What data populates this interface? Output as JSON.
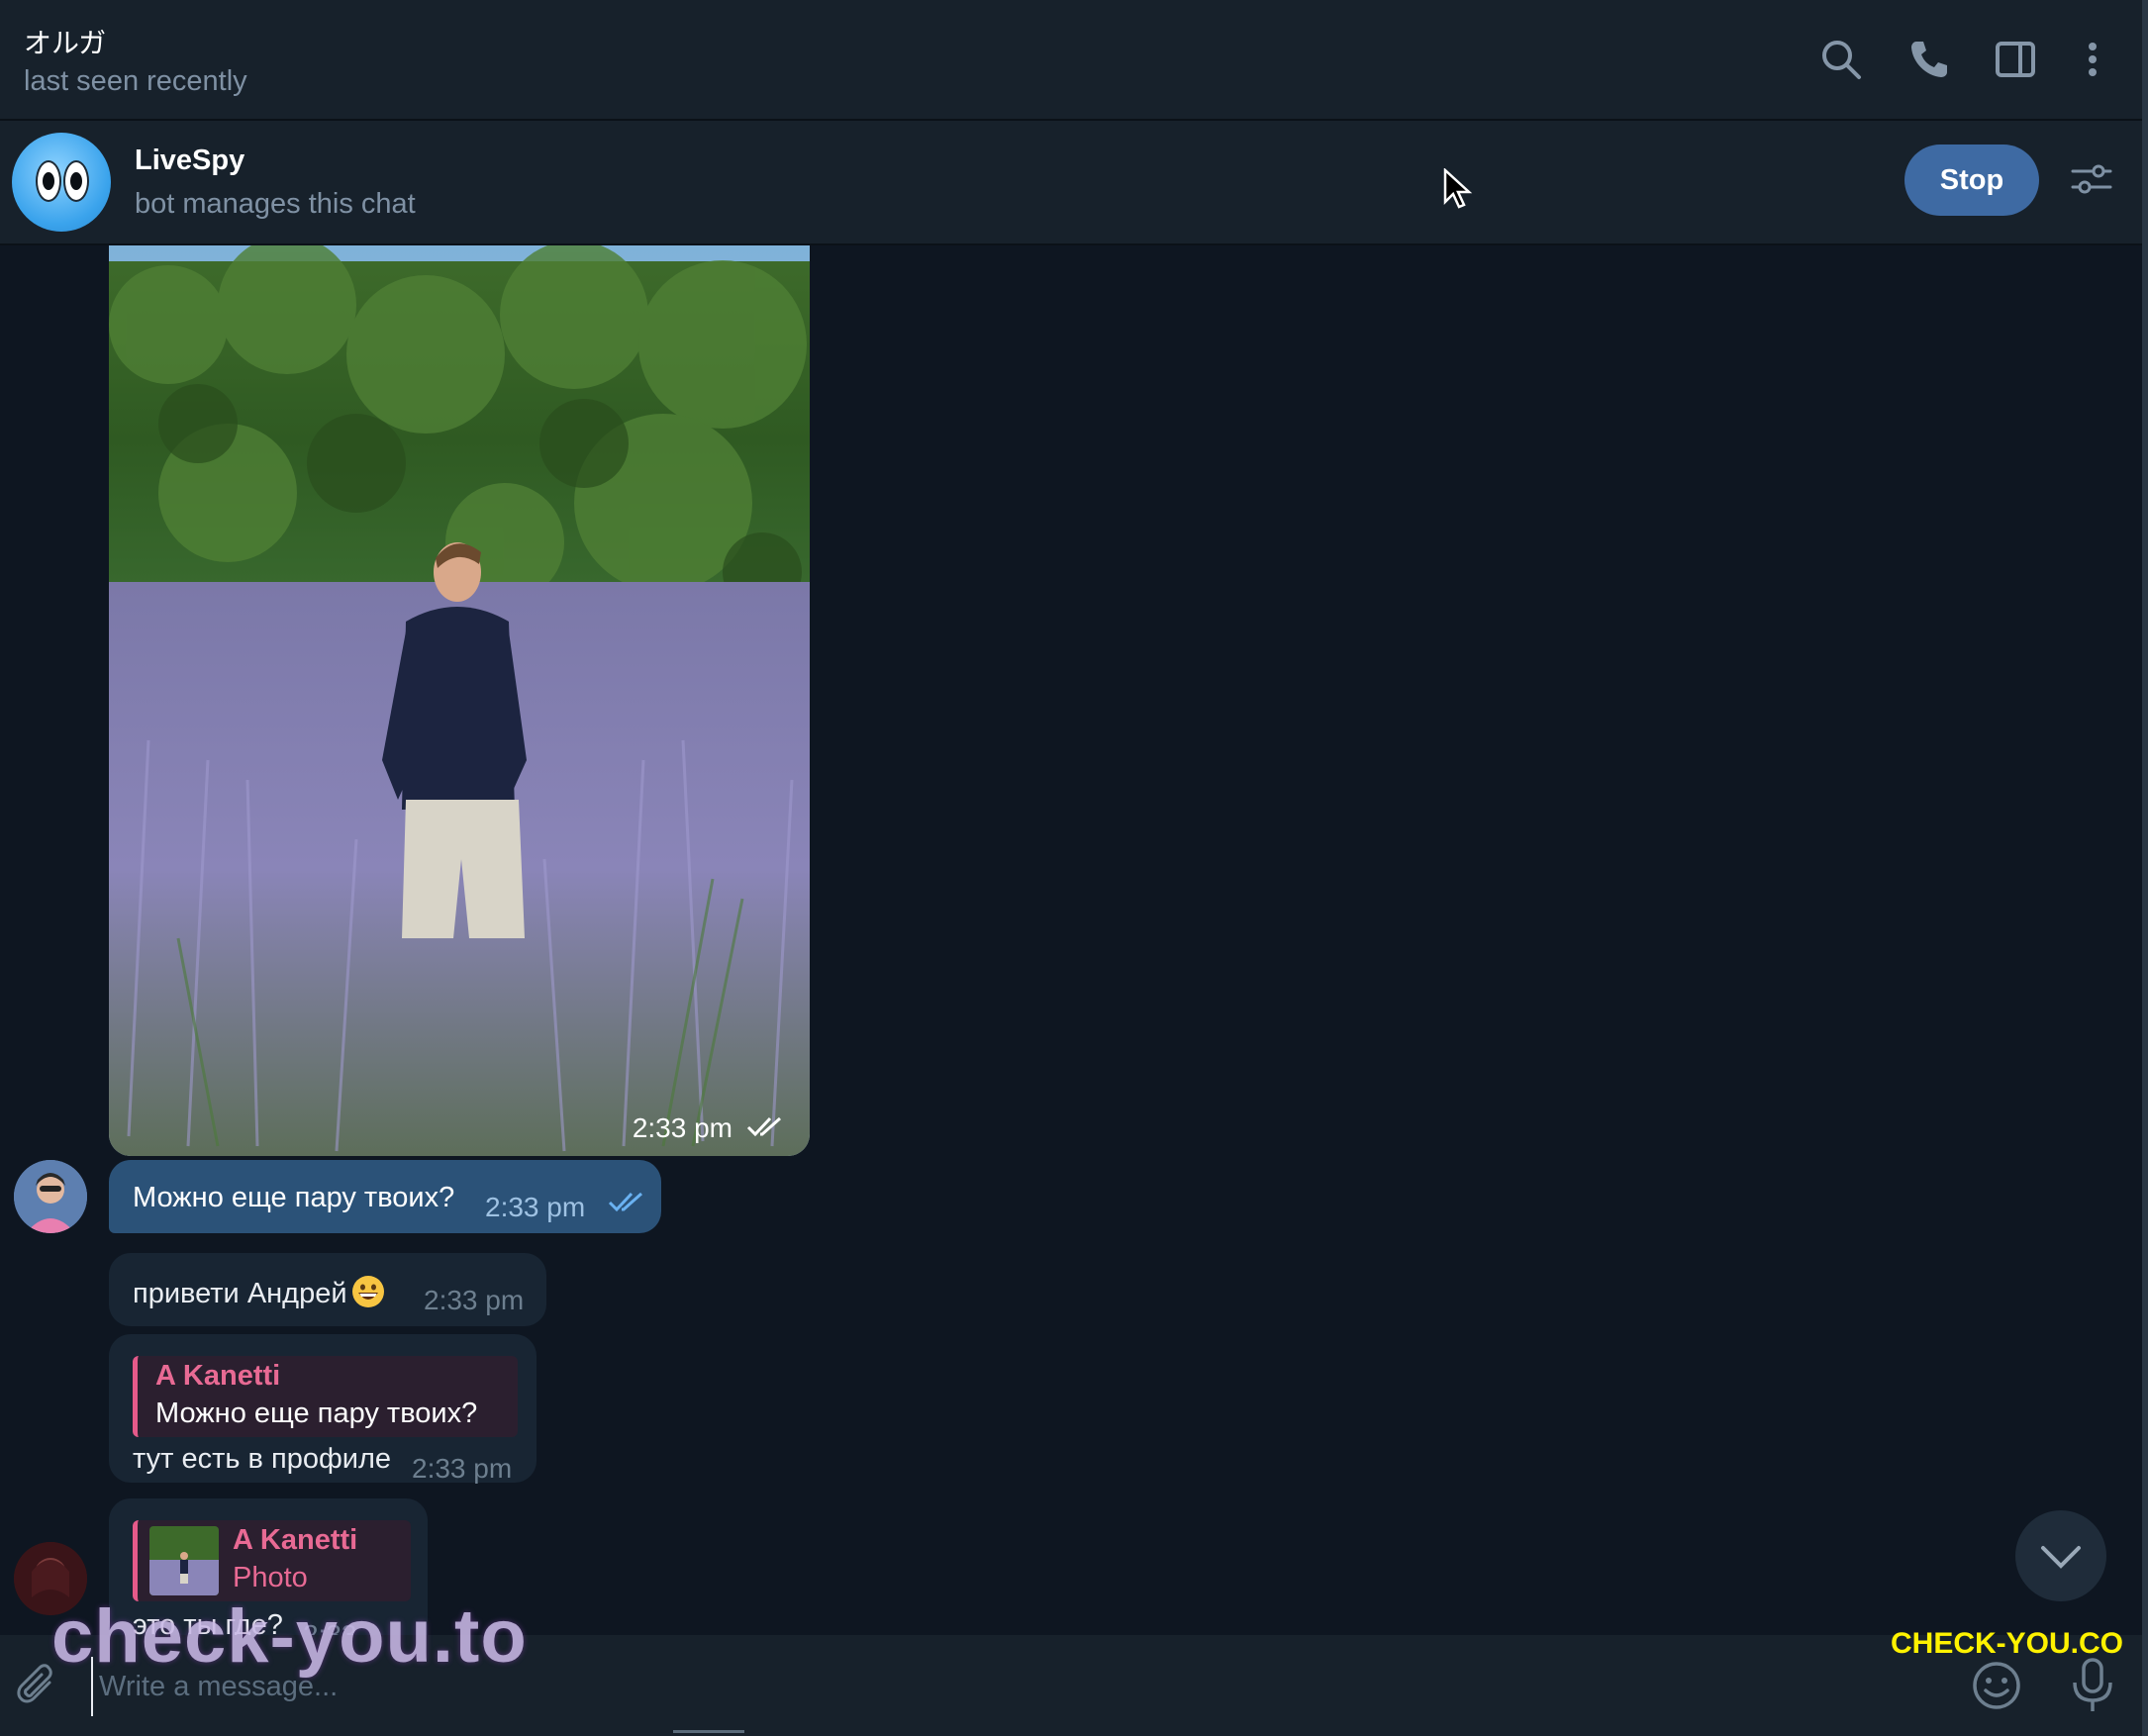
{
  "header": {
    "title": "オルガ",
    "status": "last seen recently",
    "icons": [
      "search-icon",
      "phone-icon",
      "sidebar-toggle-icon",
      "more-vertical-icon"
    ]
  },
  "bot_bar": {
    "name": "LiveSpy",
    "subtitle": "bot manages this chat",
    "stop_label": "Stop",
    "avatar_icon": "bot-eyes-avatar"
  },
  "messages": {
    "photo": {
      "time": "2:33 pm",
      "status": "delivered-double-check"
    },
    "outgoing_1": {
      "text": "Можно еще пару твоих?",
      "time": "2:33 pm",
      "status": "read-double-check"
    },
    "incoming_1": {
      "text": "привети Андрей",
      "emoji": "grinning-face",
      "time": "2:33 pm"
    },
    "incoming_2": {
      "reply_author": "A Kanetti",
      "reply_text": "Можно еще пару твоих?",
      "text": "тут есть в профиле",
      "time": "2:33 pm"
    },
    "incoming_3": {
      "reply_author": "A Kanetti",
      "reply_text": "Photo",
      "text": "это ты где?",
      "time": "2:33"
    }
  },
  "composer": {
    "placeholder": "Write a message..."
  },
  "watermarks": {
    "left": "check-you.to",
    "right": "CHECK-YOU.CO"
  },
  "colors": {
    "background": "#0e1621",
    "panel": "#17212b",
    "outgoing_bubble": "#2b5278",
    "incoming_bubble": "#182533",
    "accent": "#3e6aa3",
    "reply_accent": "#e86a94",
    "watermark_right": "#fff200"
  }
}
